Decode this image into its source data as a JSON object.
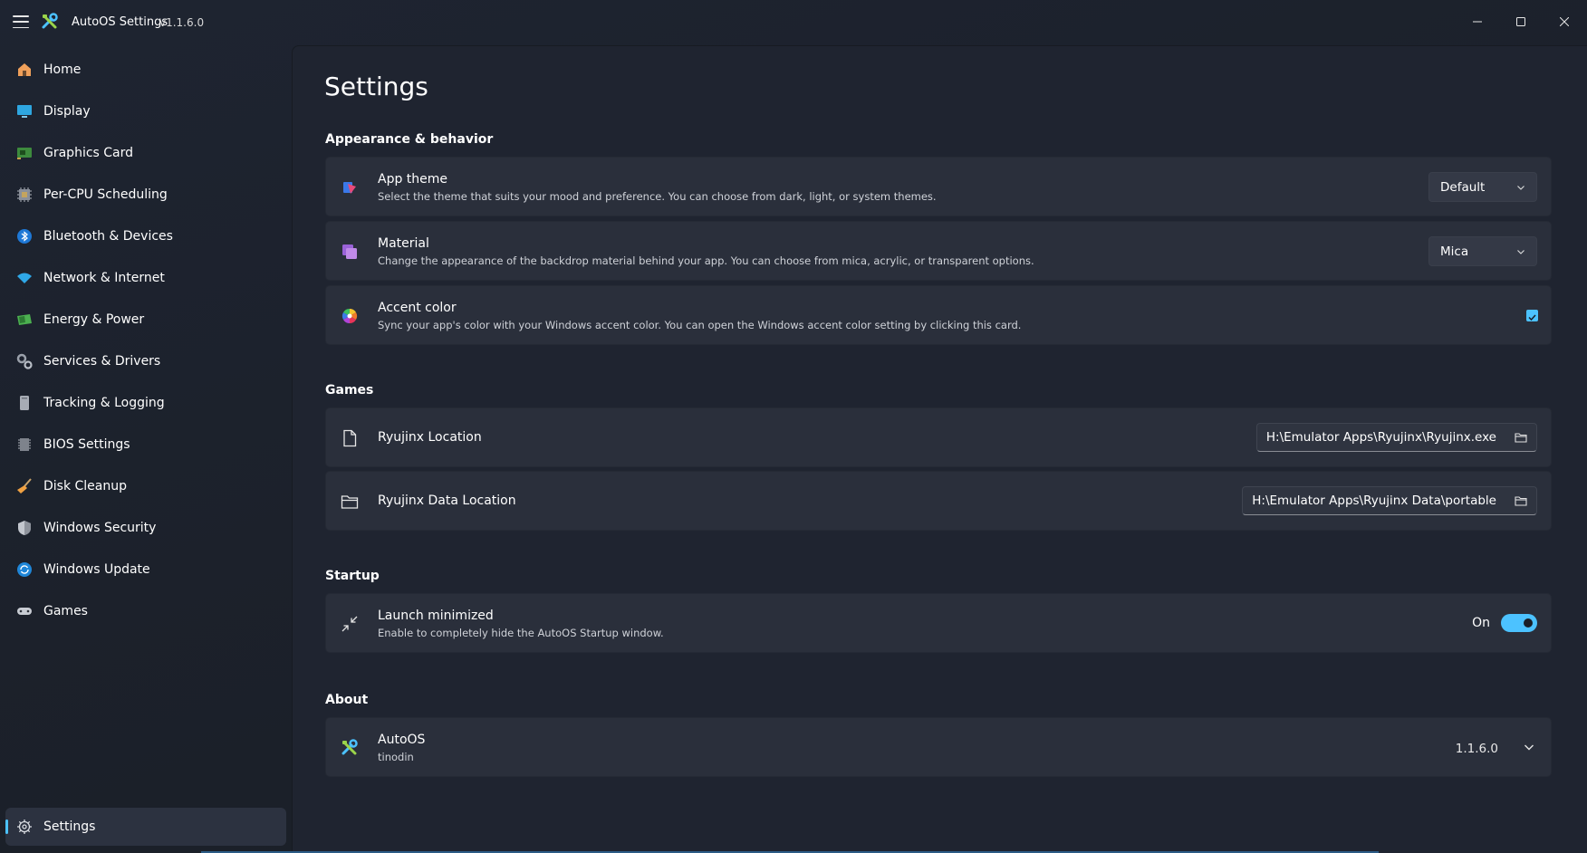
{
  "window": {
    "title": "AutoOS Settings",
    "version": "v1.1.6.0"
  },
  "sidebar": {
    "items": [
      {
        "label": "Home",
        "icon": "home-icon"
      },
      {
        "label": "Display",
        "icon": "display-icon"
      },
      {
        "label": "Graphics Card",
        "icon": "graphics-card-icon"
      },
      {
        "label": "Per-CPU Scheduling",
        "icon": "cpu-icon"
      },
      {
        "label": "Bluetooth & Devices",
        "icon": "bluetooth-icon"
      },
      {
        "label": "Network & Internet",
        "icon": "wifi-icon"
      },
      {
        "label": "Energy & Power",
        "icon": "battery-icon"
      },
      {
        "label": "Services & Drivers",
        "icon": "gears-icon"
      },
      {
        "label": "Tracking & Logging",
        "icon": "log-icon"
      },
      {
        "label": "BIOS Settings",
        "icon": "chip-icon"
      },
      {
        "label": "Disk Cleanup",
        "icon": "broom-icon"
      },
      {
        "label": "Windows Security",
        "icon": "shield-icon"
      },
      {
        "label": "Windows Update",
        "icon": "update-icon"
      },
      {
        "label": "Games",
        "icon": "gamepad-icon"
      }
    ],
    "settings_label": "Settings"
  },
  "main": {
    "title": "Settings",
    "sections": {
      "appearance": "Appearance & behavior",
      "games": "Games",
      "startup": "Startup",
      "about": "About"
    },
    "app_theme": {
      "title": "App theme",
      "description": "Select the theme that suits your mood and preference. You can choose from dark, light, or system themes.",
      "value": "Default"
    },
    "material": {
      "title": "Material",
      "description": "Change the appearance of the backdrop material behind your app. You can choose from mica, acrylic, or transparent options.",
      "value": "Mica"
    },
    "accent_color": {
      "title": "Accent color",
      "description": "Sync your app's color with your Windows accent color. You can open the Windows accent color setting by clicking this card.",
      "checked": true
    },
    "ryujinx_location": {
      "title": "Ryujinx Location",
      "value": "H:\\Emulator Apps\\Ryujinx\\Ryujinx.exe"
    },
    "ryujinx_data_location": {
      "title": "Ryujinx Data Location",
      "value": "H:\\Emulator Apps\\Ryujinx Data\\portable"
    },
    "launch_minimized": {
      "title": "Launch minimized",
      "description": "Enable to completely hide the AutoOS Startup window.",
      "state_label": "On",
      "enabled": true
    },
    "about_card": {
      "title": "AutoOS",
      "author": "tinodin",
      "version": "1.1.6.0"
    }
  },
  "colors": {
    "accent": "#4cc2ff",
    "background": "#1f2430",
    "card": "#2a2f3b"
  }
}
